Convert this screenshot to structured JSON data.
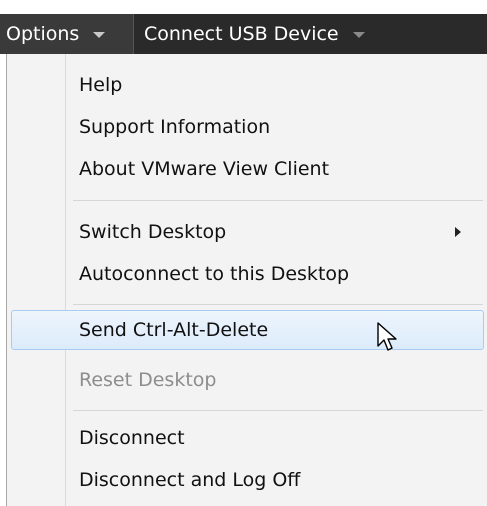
{
  "menubar": {
    "options_label": "Options",
    "connect_usb_label": "Connect USB Device"
  },
  "menu": {
    "items": [
      {
        "label": "Help",
        "enabled": true
      },
      {
        "label": "Support Information",
        "enabled": true
      },
      {
        "label": "About VMware View Client",
        "enabled": true
      },
      {
        "label": "Switch Desktop",
        "enabled": true,
        "has_submenu": true
      },
      {
        "label": "Autoconnect to this Desktop",
        "enabled": true
      },
      {
        "label": "Send Ctrl-Alt-Delete",
        "enabled": true,
        "highlighted": true
      },
      {
        "label": "Reset Desktop",
        "enabled": false
      },
      {
        "label": "Disconnect",
        "enabled": true
      },
      {
        "label": "Disconnect and Log Off",
        "enabled": true
      }
    ]
  },
  "colors": {
    "menubar_bg": "#2a2a2a",
    "menu_bg": "#f3f3f3",
    "highlight_border": "#a9cbef",
    "disabled_text": "#8d8d8d"
  },
  "icons": [
    "caret-down-icon",
    "submenu-arrow-icon",
    "mouse-pointer-icon"
  ]
}
